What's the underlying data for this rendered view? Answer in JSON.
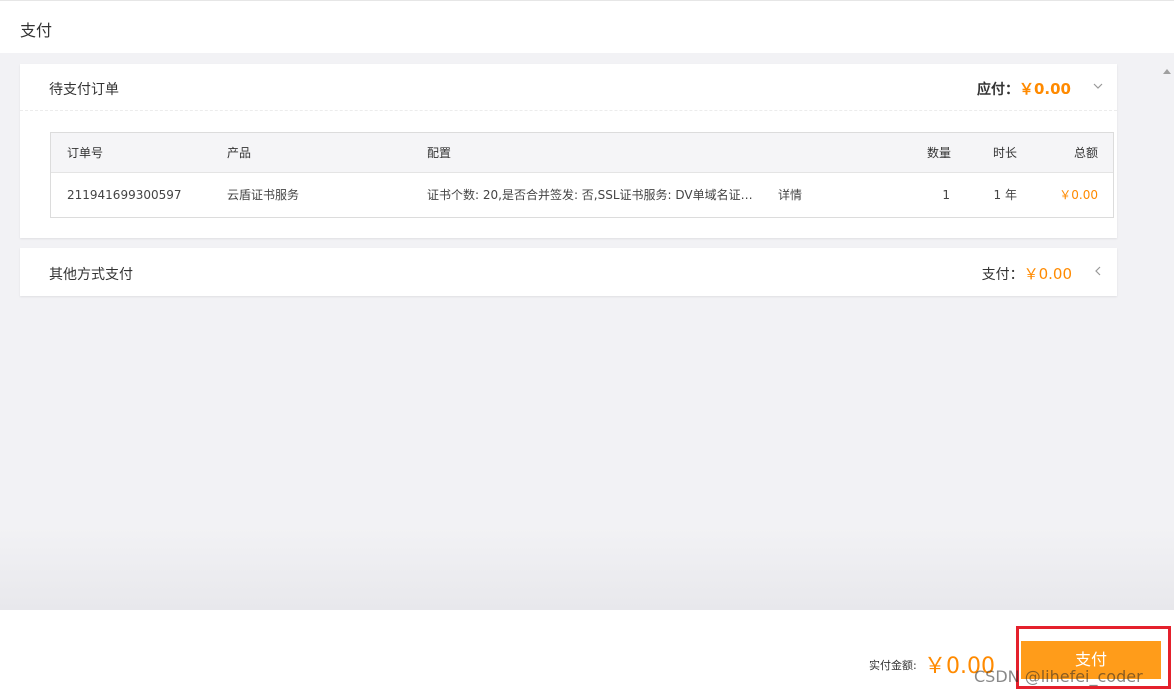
{
  "page": {
    "title": "支付"
  },
  "pending_order": {
    "title": "待支付订单",
    "summary_label": "应付：",
    "summary_amount": "￥0.00",
    "table": {
      "headers": {
        "order_no": "订单号",
        "product": "产品",
        "config": "配置",
        "quantity": "数量",
        "duration": "时长",
        "total": "总额"
      },
      "rows": [
        {
          "order_no": "211941699300597",
          "product": "云盾证书服务",
          "config": "证书个数: 20,是否合并签发: 否,SSL证书服务: DV单域名证书...",
          "detail": "详情",
          "quantity": "1",
          "duration": "1 年",
          "total": "￥0.00"
        }
      ]
    }
  },
  "other_payment": {
    "title": "其他方式支付",
    "summary_label": "支付：",
    "summary_amount": "￥0.00"
  },
  "footer": {
    "actual_label": "实付金额:",
    "actual_amount": "￥0.00",
    "pay_button_label": "支付"
  },
  "watermark": "CSDN @lihefei_coder",
  "colors": {
    "accent": "#ff8a00",
    "pay_button": "#ff9c1a",
    "link": "#4a7ee6",
    "highlight_frame": "#e4202c"
  }
}
